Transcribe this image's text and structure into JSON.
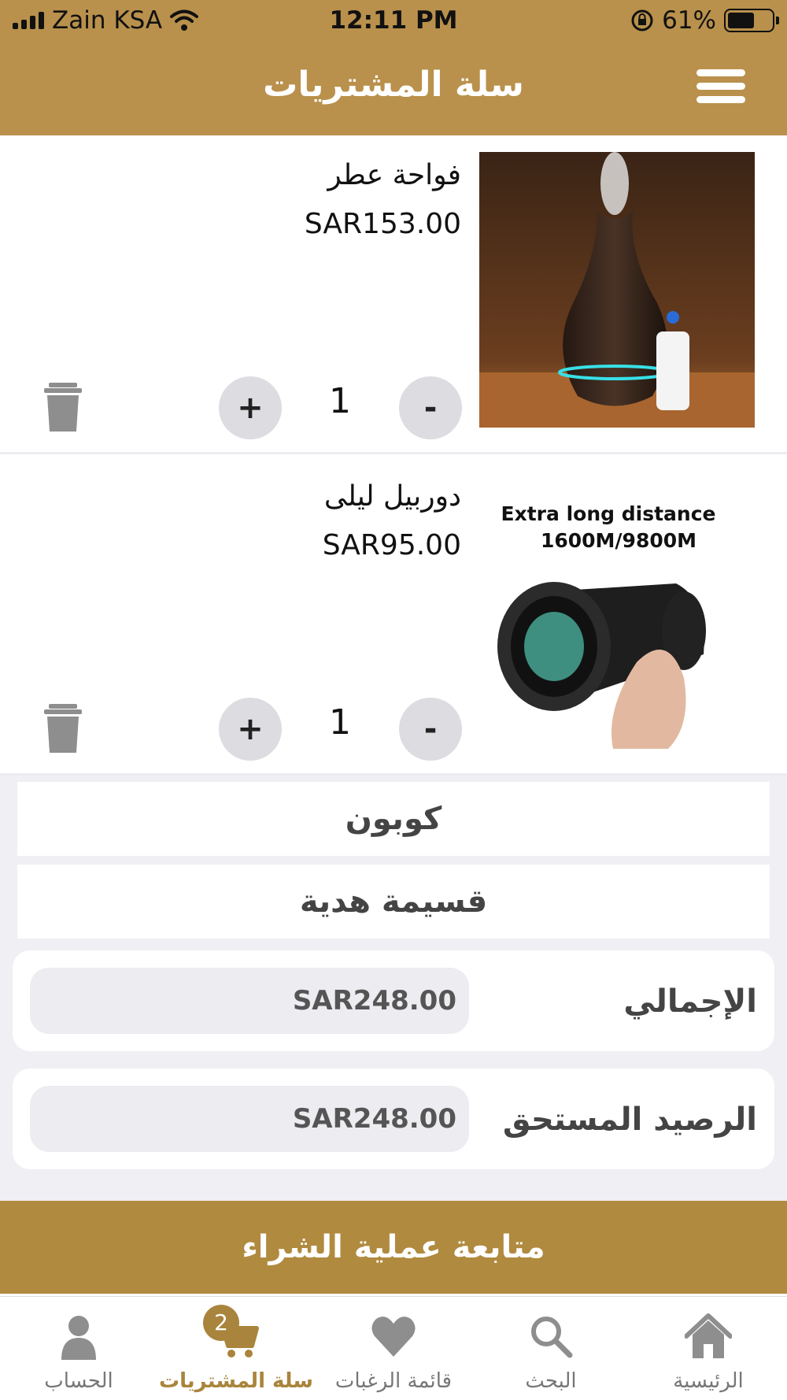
{
  "status_bar": {
    "carrier": "Zain KSA",
    "time": "12:11 PM",
    "battery_percent": "61%",
    "battery_level": 0.61
  },
  "header": {
    "title": "سلة المشتريات",
    "menu_icon": "hamburger-menu-icon"
  },
  "cart_items": [
    {
      "name": "فواحة عطر",
      "price": "SAR153.00",
      "quantity": "1",
      "minus_label": "-",
      "plus_label": "+",
      "image": "aroma-diffuser-photo"
    },
    {
      "name": "دوربيل ليلى",
      "price": "SAR95.00",
      "quantity": "1",
      "minus_label": "-",
      "plus_label": "+",
      "image": "monocular-photo",
      "image_caption_line1": "Extra long distance",
      "image_caption_line2": "1600M/9800M"
    }
  ],
  "summary": {
    "coupon_label": "كوبون",
    "gift_card_label": "قسيمة هدية",
    "total_label": "الإجمالي",
    "total_value": "SAR248.00",
    "balance_due_label": "الرصيد المستحق",
    "balance_due_value": "SAR248.00"
  },
  "checkout_label": "متابعة عملية الشراء",
  "tab_bar": {
    "tabs": [
      {
        "label": "الحساب",
        "icon": "person-icon"
      },
      {
        "label": "سلة المشتريات",
        "icon": "cart-icon",
        "badge": "2",
        "active": true
      },
      {
        "label": "قائمة الرغبات",
        "icon": "heart-icon"
      },
      {
        "label": "البحث",
        "icon": "search-icon"
      },
      {
        "label": "الرئيسية",
        "icon": "home-icon"
      }
    ]
  },
  "colors": {
    "header": "#b9914c",
    "accent": "#a9843c",
    "checkout": "#b08a3e",
    "background_gray": "#efeff4"
  }
}
